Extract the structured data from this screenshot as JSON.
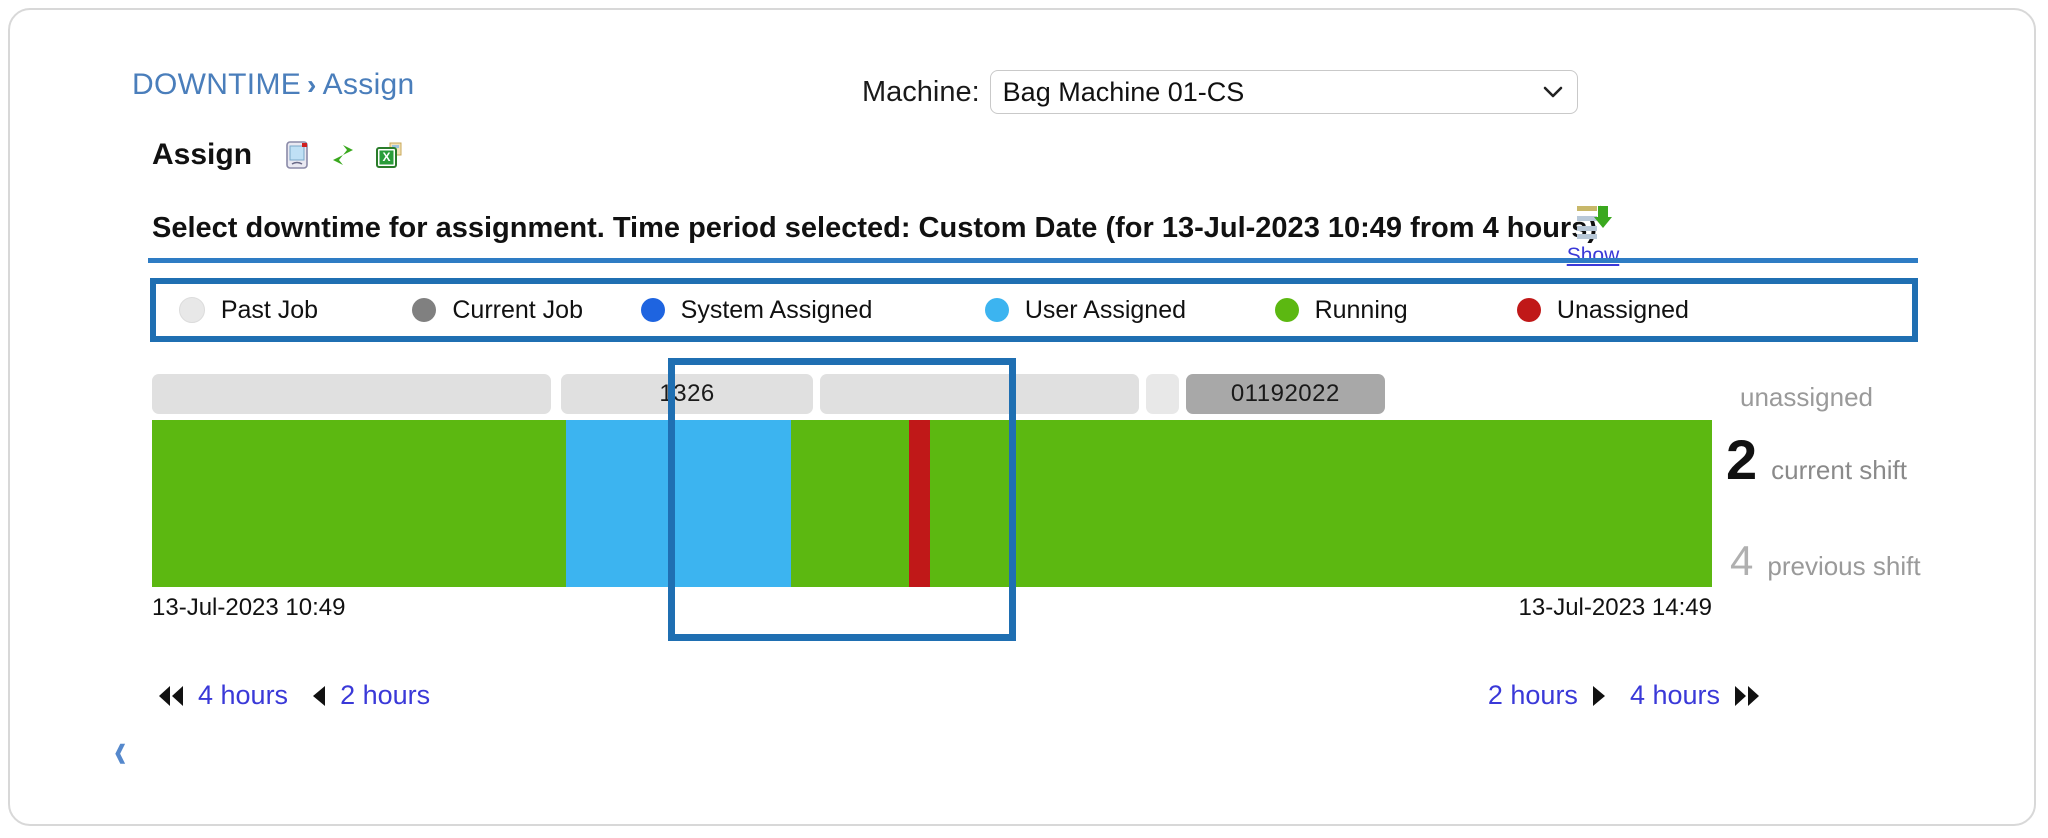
{
  "breadcrumb": {
    "root": "DOWNTIME",
    "separator": "›",
    "leaf": "Assign"
  },
  "machine": {
    "label": "Machine:",
    "selected": "Bag Machine 01-CS",
    "chevron_icon": "chevron-down-icon"
  },
  "toolbar": {
    "title": "Assign",
    "icons": [
      {
        "name": "device-screen-icon"
      },
      {
        "name": "refresh-icon"
      },
      {
        "name": "excel-export-icon"
      }
    ]
  },
  "instruction": {
    "text": "Select downtime for assignment. Time period selected: Custom Date (for 13-Jul-2023 10:49 from 4 hours)",
    "show_icon": "export-download-icon",
    "show_label": "Show"
  },
  "legend": {
    "items": [
      {
        "label": "Past Job",
        "color": "#e8e8e8"
      },
      {
        "label": "Current Job",
        "color": "#808080"
      },
      {
        "label": "System Assigned",
        "color": "#1e64e0"
      },
      {
        "label": "User Assigned",
        "color": "#3cb4f0"
      },
      {
        "label": "Running",
        "color": "#5cb811"
      },
      {
        "label": "Unassigned",
        "color": "#c01818"
      }
    ],
    "positions": [
      0.013,
      0.146,
      0.276,
      0.472,
      0.637,
      0.775
    ]
  },
  "timeline": {
    "job_segments": [
      {
        "label": "",
        "color": "#e0e0e0",
        "start": 0.0,
        "width": 0.256
      },
      {
        "label": "1326",
        "color": "#e0e0e0",
        "start": 0.262,
        "width": 0.162
      },
      {
        "label": "",
        "color": "#e0e0e0",
        "start": 0.428,
        "width": 0.205
      },
      {
        "label": "",
        "color": "#e8e8e8",
        "start": 0.637,
        "width": 0.0215
      },
      {
        "label": "01192022",
        "color": "#a8a8a8",
        "start": 0.6625,
        "width": 0.128
      }
    ],
    "bar_segments": [
      {
        "status": "Running",
        "color": "#5cb811",
        "start": 0.0,
        "width": 0.2655
      },
      {
        "status": "User Assigned",
        "color": "#3cb4f0",
        "start": 0.2655,
        "width": 0.1443
      },
      {
        "status": "Running",
        "color": "#5cb811",
        "start": 0.4098,
        "width": 0.0755
      },
      {
        "status": "Unassigned",
        "color": "#c01818",
        "start": 0.4853,
        "width": 0.0135
      },
      {
        "status": "Running",
        "color": "#5cb811",
        "start": 0.4988,
        "width": 0.5012
      }
    ],
    "start_time": "13-Jul-2023 10:49",
    "end_time": "13-Jul-2023 14:49"
  },
  "side_labels": {
    "unassigned": "unassigned",
    "current_shift_count": "2",
    "current_shift_label": "current shift",
    "previous_shift_count": "4",
    "previous_shift_label": "previous shift"
  },
  "nav": {
    "left": [
      {
        "icon": "double-left-arrow-icon",
        "label": "4 hours"
      },
      {
        "icon": "left-arrow-icon",
        "label": "2 hours"
      }
    ],
    "right": [
      {
        "label": "2 hours",
        "icon": "right-arrow-icon"
      },
      {
        "label": "4 hours",
        "icon": "double-right-arrow-icon"
      }
    ]
  },
  "annotation": {
    "accent_color": "#1f6fb2"
  }
}
